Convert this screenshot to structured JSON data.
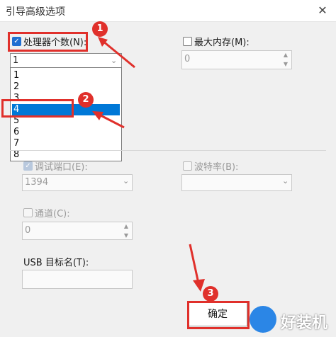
{
  "window": {
    "title": "引导高级选项",
    "close_glyph": "✕"
  },
  "processors": {
    "label": "处理器个数(N):",
    "checked": true,
    "value": "1",
    "options": [
      "1",
      "2",
      "3",
      "4",
      "5",
      "6",
      "7",
      "8"
    ],
    "highlighted": "4"
  },
  "max_memory": {
    "label": "最大内存(M):",
    "value": "0"
  },
  "debug_port": {
    "label": "调试端口(E):",
    "value": "1394"
  },
  "baud_rate": {
    "label": "波特率(B):",
    "value": ""
  },
  "channel": {
    "label": "通道(C):",
    "value": "0"
  },
  "usb_target": {
    "label": "USB 目标名(T):",
    "value": ""
  },
  "buttons": {
    "ok_label": "确定"
  },
  "annotations": {
    "badge1": "1",
    "badge2": "2",
    "badge3": "3"
  },
  "watermark": {
    "text": "好装机"
  },
  "colors": {
    "annotation_red": "#e0302b",
    "selection_blue": "#0078d7"
  }
}
